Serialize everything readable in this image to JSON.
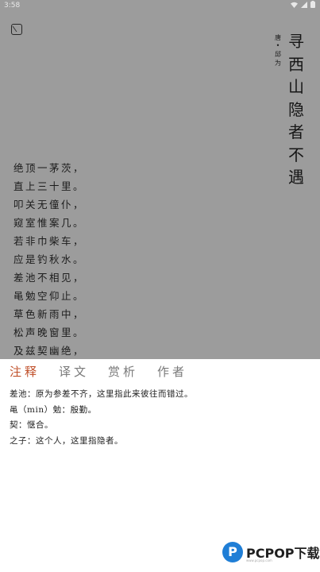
{
  "status_bar": {
    "time": "3:58"
  },
  "poem": {
    "title": [
      "寻",
      "西",
      "山",
      "隐",
      "者",
      "不",
      "遇"
    ],
    "author_meta": [
      "唐",
      "•",
      "邱",
      "为"
    ],
    "lines": [
      "绝顶一茅茨，",
      "直上三十里。",
      "叩关无僮仆，",
      "窥室惟案几。",
      "若非巾柴车，",
      "应是钓秋水。",
      "差池不相见，",
      "黾勉空仰止。",
      "草色新雨中，",
      "松声晚窗里。",
      "及兹契幽绝，"
    ]
  },
  "tabs": [
    {
      "label": "注释",
      "active": true
    },
    {
      "label": "译文",
      "active": false
    },
    {
      "label": "赏析",
      "active": false
    },
    {
      "label": "作者",
      "active": false
    }
  ],
  "notes": [
    "差池：原为参差不齐，这里指此来彼往而错过。",
    "黾（min）勉：殷勤。",
    "契：惬合。",
    "之子：这个人，这里指隐者。"
  ],
  "watermark": {
    "brand": "PCPOP下载",
    "sub": "www.pcpop.com",
    "logo_letter": "P"
  },
  "colors": {
    "overlay": "#9c9c9c",
    "active_tab": "#c0502a",
    "logo": "#1f7ed6"
  }
}
